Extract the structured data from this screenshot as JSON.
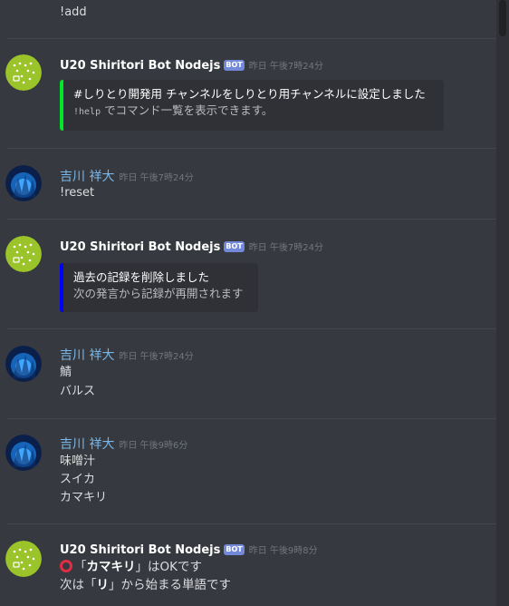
{
  "messages": [
    {
      "text": "!add"
    },
    {
      "author": "U20 Shiritori Bot Nodejs",
      "bot_tag": "BOT",
      "time": "昨日 午後7時24分",
      "embed": {
        "color": "#00e628",
        "title": "#しりとり開発用 チャンネルをしりとり用チャンネルに設定しました",
        "code": "!help",
        "desc": "でコマンド一覧を表示できます。"
      }
    },
    {
      "author": "吉川 祥大",
      "time": "昨日 午後7時24分",
      "text": "!reset"
    },
    {
      "author": "U20 Shiritori Bot Nodejs",
      "bot_tag": "BOT",
      "time": "昨日 午後7時24分",
      "embed": {
        "color": "#0000ff",
        "title": "過去の記録を削除しました",
        "desc": "次の発言から記録が再開されます"
      }
    },
    {
      "author": "吉川 祥大",
      "time": "昨日 午後7時24分",
      "lines": [
        "鯖",
        "バルス"
      ]
    },
    {
      "author": "吉川 祥大",
      "time": "昨日 午後9時6分",
      "lines": [
        "味噌汁",
        "スイカ",
        "カマキリ"
      ]
    },
    {
      "author": "U20 Shiritori Bot Nodejs",
      "bot_tag": "BOT",
      "time": "昨日 午後9時8分",
      "reply": {
        "icon": "red-circle-icon",
        "open1": "「",
        "word": "カマキリ",
        "close1": "」",
        "mid1": "はOKです",
        "prefix2": "次は「",
        "kana": "リ",
        "suffix2": "」から始まる単語です"
      }
    }
  ]
}
